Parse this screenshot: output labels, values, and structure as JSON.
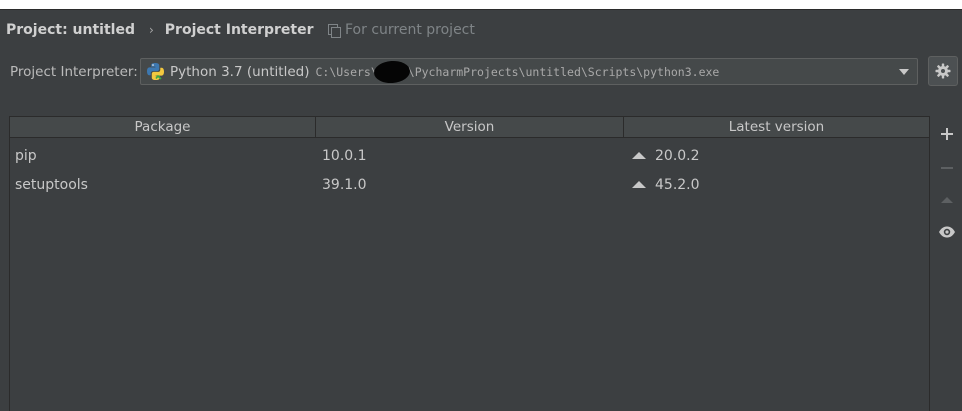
{
  "breadcrumb": {
    "project": "Project: untitled",
    "separator": "›",
    "page": "Project Interpreter"
  },
  "scope_note": "For current project",
  "interpreter": {
    "label": "Project Interpreter:",
    "name": "Python 3.7 (untitled)",
    "path_prefix": "C:\\Users\\",
    "path_suffix": "\\PycharmProjects\\untitled\\Scripts\\python3.exe"
  },
  "table": {
    "headers": [
      "Package",
      "Version",
      "Latest version"
    ],
    "rows": [
      {
        "package": "pip",
        "version": "10.0.1",
        "latest": "20.0.2"
      },
      {
        "package": "setuptools",
        "version": "39.1.0",
        "latest": "45.2.0"
      }
    ]
  },
  "icons": {
    "settings": "gear-icon",
    "add": "plus-icon",
    "remove": "minus-icon",
    "upgrade": "upgrade-icon",
    "show_early_releases": "eye-icon",
    "python": "python-icon"
  },
  "colors": {
    "background": "#3c3f41",
    "text": "#bbbbbb",
    "muted": "#7f8487",
    "field": "#45494a"
  }
}
